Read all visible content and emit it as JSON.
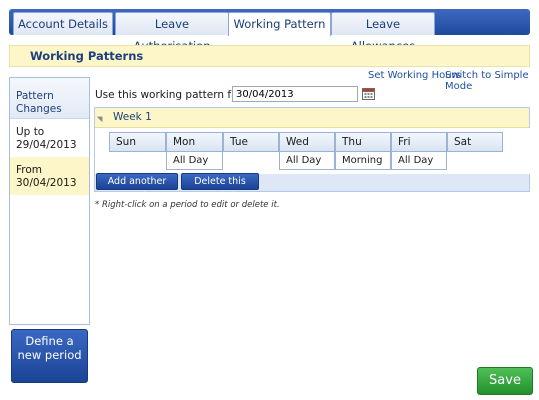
{
  "tabs": [
    {
      "label": "Account Details",
      "active": false
    },
    {
      "label": "Leave Authorisation",
      "active": false
    },
    {
      "label": "Working Pattern",
      "active": true
    },
    {
      "label": "Leave Allowances",
      "active": false
    }
  ],
  "section": {
    "title": "Working Patterns"
  },
  "links": {
    "set_hours": "Set Working Hours",
    "simple_mode": "Switch to Simple Mode"
  },
  "pattern_changes": {
    "header": "Pattern Changes",
    "items": [
      {
        "label": "Up to 29/04/2013",
        "selected": false
      },
      {
        "label": "From 30/04/2013",
        "selected": true
      }
    ]
  },
  "define_button": "Define a new period",
  "pattern_from": {
    "label": "Use this working pattern from",
    "value": "30/04/2013"
  },
  "week": {
    "title": "Week 1",
    "days": [
      {
        "name": "Sun",
        "value": ""
      },
      {
        "name": "Mon",
        "value": "All Day"
      },
      {
        "name": "Tue",
        "value": ""
      },
      {
        "name": "Wed",
        "value": "All Day"
      },
      {
        "name": "Thu",
        "value": "Morning"
      },
      {
        "name": "Fri",
        "value": "All Day"
      },
      {
        "name": "Sat",
        "value": ""
      }
    ]
  },
  "buttons": {
    "add_week": "Add another week",
    "delete_period": "Delete this period",
    "save": "Save"
  },
  "hint": "* Right-click on a period to edit or delete it.",
  "colors": {
    "tab_bar": "#1e4a9e",
    "highlight": "#fdf6c8",
    "save": "#23912c"
  }
}
